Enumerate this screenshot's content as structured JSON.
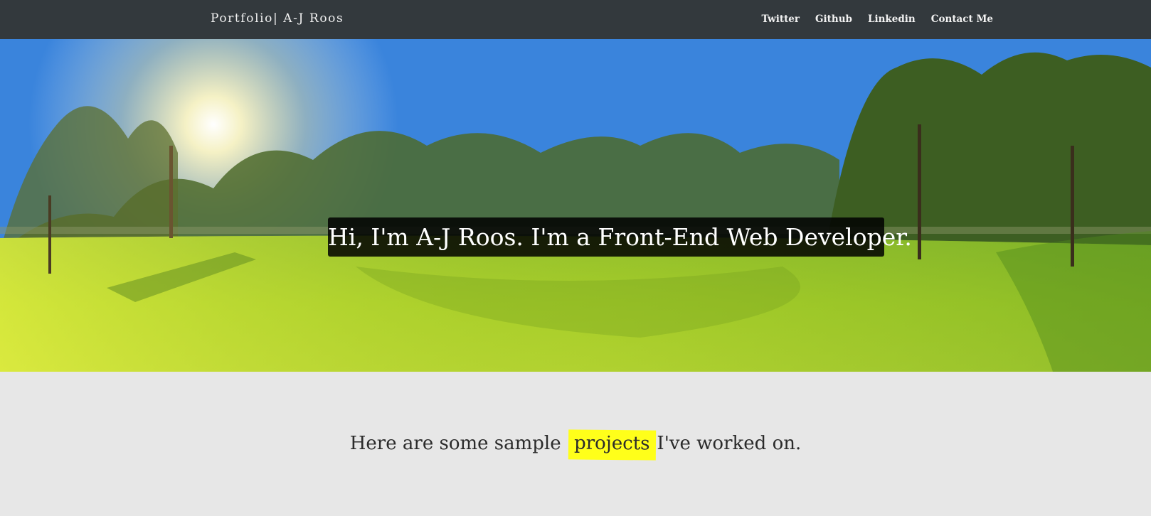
{
  "navbar": {
    "brand": "Portfolio| A-J Roos",
    "links": [
      "Twitter",
      "Github",
      "Linkedin",
      "Contact Me"
    ]
  },
  "hero": {
    "headline": "Hi, I'm A-J Roos. I'm a Front-End Web Developer.",
    "image": "sunny park panorama with trees and green grass"
  },
  "projects": {
    "intro_before": "Here are some sample",
    "intro_highlight": "projects",
    "intro_after": "I've worked on.",
    "highlight_color": "#ffff1a"
  },
  "colors": {
    "navbar_bg": "#33393d",
    "page_bg": "#e7e7e7"
  }
}
